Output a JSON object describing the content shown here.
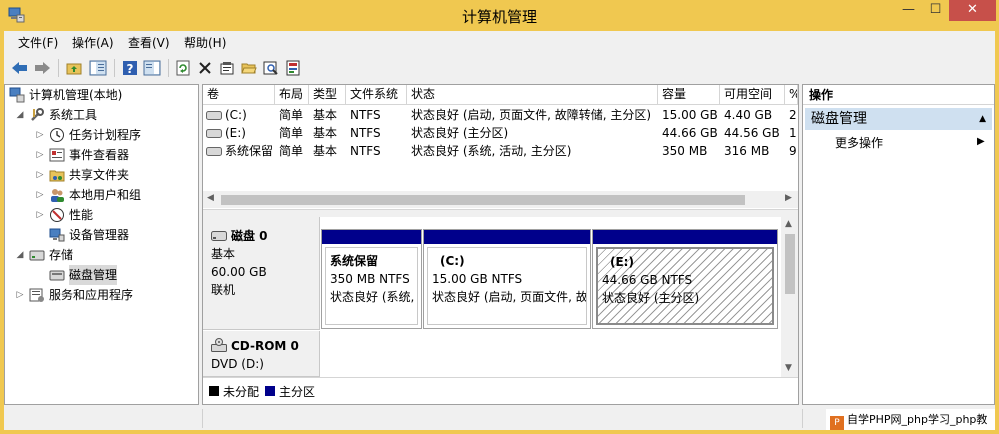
{
  "window": {
    "title": "计算机管理",
    "min_label": "—",
    "max_label": "☐",
    "close_label": "✕"
  },
  "menu": [
    "文件(F)",
    "操作(A)",
    "查看(V)",
    "帮助(H)"
  ],
  "tree": {
    "root": "计算机管理(本地)",
    "system_tools": "系统工具",
    "task_scheduler": "任务计划程序",
    "event_viewer": "事件查看器",
    "shared_folders": "共享文件夹",
    "local_users": "本地用户和组",
    "performance": "性能",
    "device_manager": "设备管理器",
    "storage": "存储",
    "disk_management": "磁盘管理",
    "services_apps": "服务和应用程序"
  },
  "volume_table": {
    "headers": [
      "卷",
      "布局",
      "类型",
      "文件系统",
      "状态",
      "容量",
      "可用空间",
      "%"
    ],
    "rows": [
      [
        "(C:)",
        "简单",
        "基本",
        "NTFS",
        "状态良好 (启动, 页面文件, 故障转储, 主分区)",
        "15.00 GB",
        "4.40 GB",
        "2"
      ],
      [
        "(E:)",
        "简单",
        "基本",
        "NTFS",
        "状态良好 (主分区)",
        "44.66 GB",
        "44.56 GB",
        "1"
      ],
      [
        "系统保留",
        "简单",
        "基本",
        "NTFS",
        "状态良好 (系统, 活动, 主分区)",
        "350 MB",
        "316 MB",
        "9"
      ]
    ]
  },
  "disks": [
    {
      "name": "磁盘 0",
      "type": "基本",
      "size": "60.00 GB",
      "status": "联机",
      "partitions": [
        {
          "name": "系统保留",
          "info": "350 MB NTFS",
          "status": "状态良好 (系统,"
        },
        {
          "name": "(C:)",
          "info": "15.00 GB NTFS",
          "status": "状态良好 (启动, 页面文件, 故"
        },
        {
          "name": "(E:)",
          "info": "44.66 GB NTFS",
          "status": "状态良好 (主分区)"
        }
      ]
    },
    {
      "name": "CD-ROM 0",
      "type": "DVD (D:)"
    }
  ],
  "legend": [
    {
      "label": "未分配",
      "color": "#000000"
    },
    {
      "label": "主分区",
      "color": "#00008b"
    }
  ],
  "actions": {
    "header": "操作",
    "group": "磁盘管理",
    "more": "更多操作"
  },
  "watermark": "自学PHP网_php学习_php教"
}
